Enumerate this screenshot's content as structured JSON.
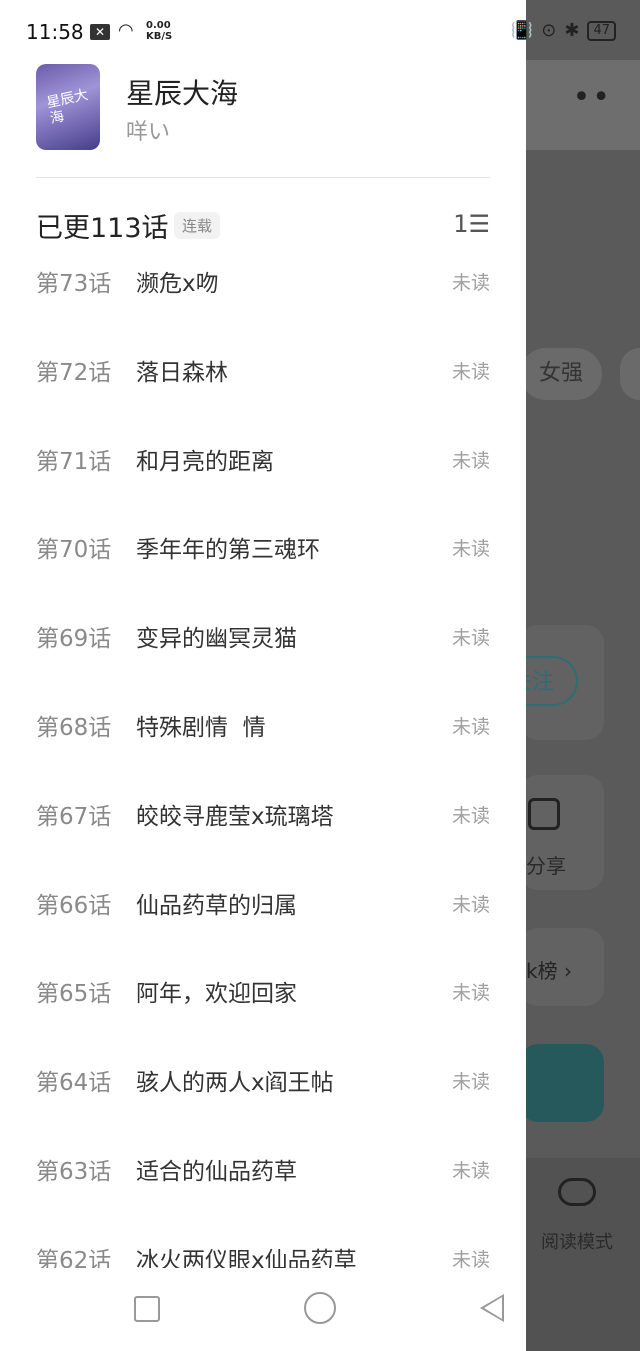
{
  "status_bar": {
    "time": "11:58",
    "net_speed_value": "0.00",
    "net_speed_unit": "KB/S",
    "battery": "47"
  },
  "book": {
    "title": "星辰大海",
    "author": "咩い",
    "cover_text": "星辰大海"
  },
  "chapter_list": {
    "updated_label": "已更113话",
    "status_tag": "连载",
    "chapters": [
      {
        "num": "第73话",
        "title": "濒危x吻",
        "state": "未读"
      },
      {
        "num": "第72话",
        "title": "落日森林",
        "state": "未读"
      },
      {
        "num": "第71话",
        "title": "和月亮的距离",
        "state": "未读"
      },
      {
        "num": "第70话",
        "title": "季年年的第三魂环",
        "state": "未读"
      },
      {
        "num": "第69话",
        "title": "变异的幽冥灵猫",
        "state": "未读"
      },
      {
        "num": "第68话",
        "title": "特殊剧情  情",
        "state": "未读"
      },
      {
        "num": "第67话",
        "title": "皎皎寻鹿莹x琉璃塔",
        "state": "未读"
      },
      {
        "num": "第66话",
        "title": "仙品药草的归属",
        "state": "未读"
      },
      {
        "num": "第65话",
        "title": "阿年，欢迎回家",
        "state": "未读"
      },
      {
        "num": "第64话",
        "title": "骇人的两人x阎王帖",
        "state": "未读"
      },
      {
        "num": "第63话",
        "title": "适合的仙品药草",
        "state": "未读"
      },
      {
        "num": "第62话",
        "title": "冰火两仪眼x仙品药草",
        "state": "未读"
      }
    ]
  },
  "background": {
    "chip": "女强",
    "follow": "关注",
    "share": "分享",
    "rank": "k榜 ›",
    "mode": "阅读模式"
  }
}
